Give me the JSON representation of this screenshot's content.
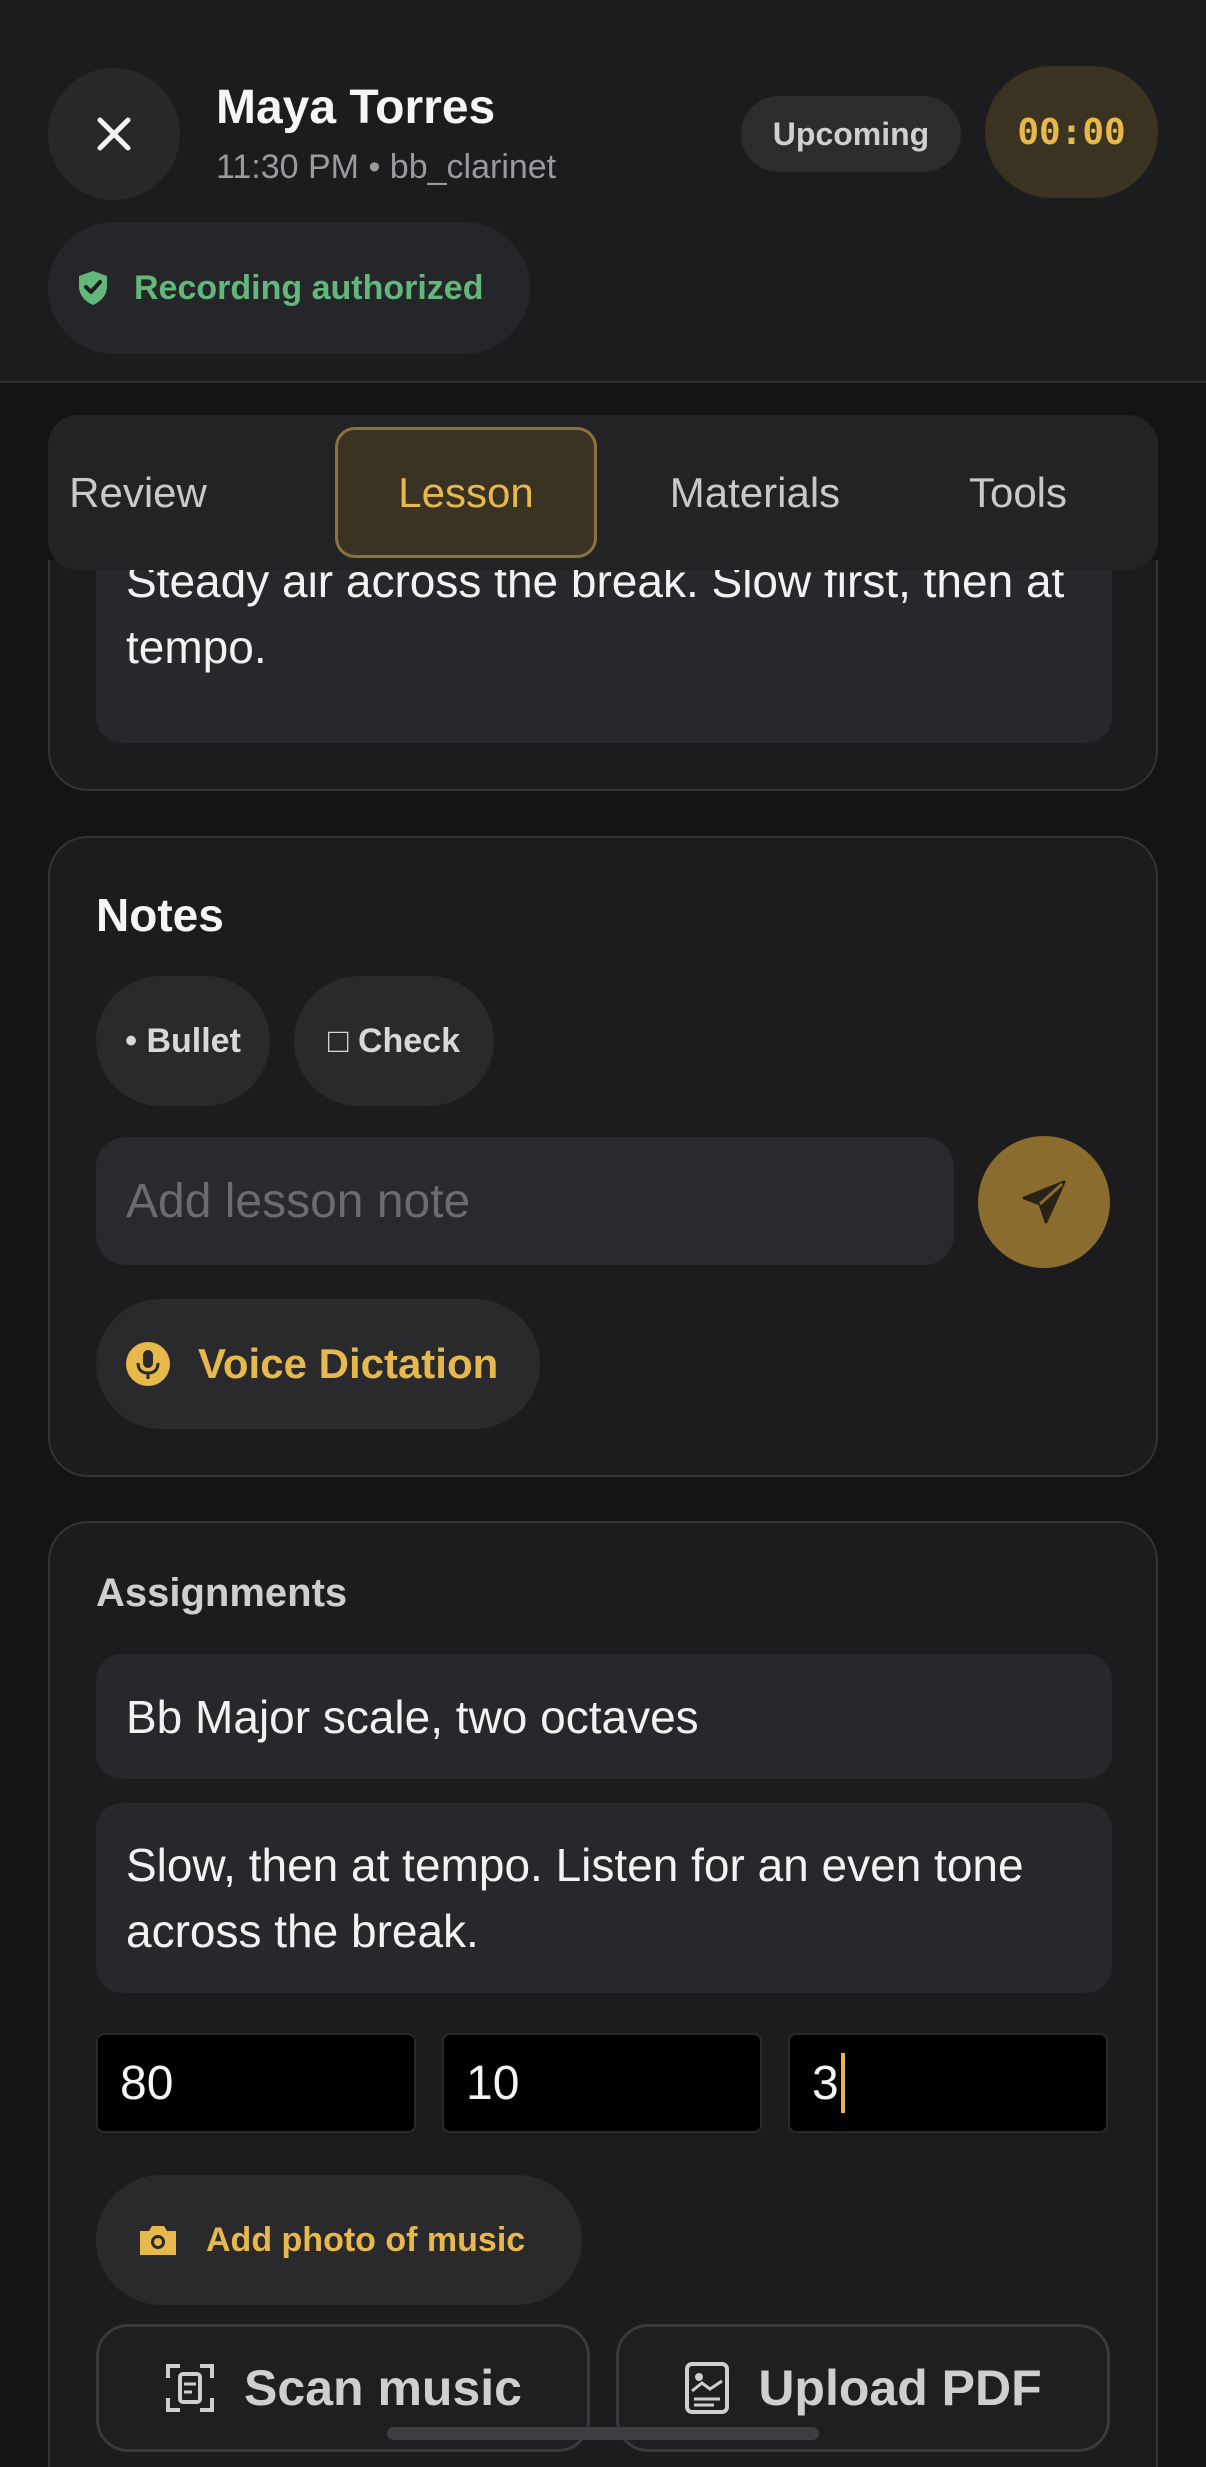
{
  "header": {
    "student_name": "Maya Torres",
    "subtitle": "11:30 PM • bb_clarinet",
    "status": "Upcoming",
    "timer": "00:00",
    "recording_label": "Recording authorized"
  },
  "tabs": [
    {
      "label": "Review",
      "active": false
    },
    {
      "label": "Lesson",
      "active": true
    },
    {
      "label": "Materials",
      "active": false
    },
    {
      "label": "Tools",
      "active": false
    }
  ],
  "focus_card": {
    "text": "Steady air across the break. Slow first, then at tempo."
  },
  "notes": {
    "title": "Notes",
    "bullet_chip": "• Bullet",
    "check_chip": "□ Check",
    "input_placeholder": "Add lesson note",
    "voice_label": "Voice Dictation"
  },
  "assignments": {
    "title": "Assignments",
    "assignment_title": "Bb Major scale, two octaves",
    "assignment_description": "Slow, then at tempo. Listen for an even tone across the break.",
    "fields": [
      "80",
      "10",
      "3"
    ],
    "add_photo_label": "Add photo of music",
    "scan_label": "Scan music",
    "upload_label": "Upload PDF"
  },
  "colors": {
    "accent": "#e7b94c",
    "success": "#62b77a",
    "background": "#141416",
    "card": "#1c1c1f"
  }
}
